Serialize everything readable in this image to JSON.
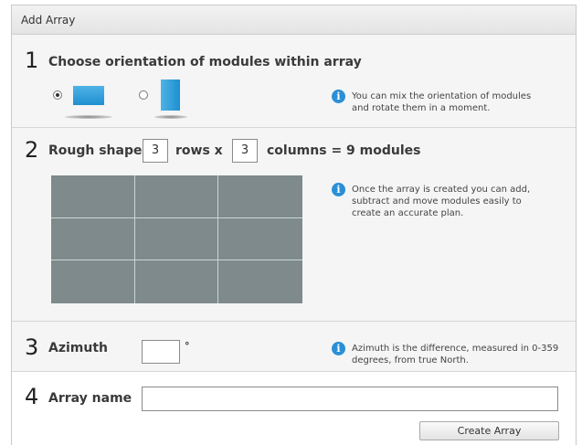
{
  "dialog": {
    "title": "Add Array"
  },
  "step1": {
    "number": "1",
    "heading": "Choose orientation of modules within array",
    "orientations": [
      {
        "name": "landscape",
        "selected": true
      },
      {
        "name": "portrait",
        "selected": false
      }
    ],
    "info_icon": "info-icon",
    "info_line1": "You can mix the orientation of modules",
    "info_line2": "and rotate them in a moment."
  },
  "step2": {
    "number": "2",
    "label_prefix": "Rough shape",
    "rows_value": "3",
    "rows_label": "rows x",
    "columns_value": "3",
    "columns_label": "columns = 9 modules",
    "grid_rows": 3,
    "grid_columns": 3,
    "info_line1": "Once the array is created you can add,",
    "info_line2": "subtract and move modules easily to",
    "info_line3": "create an accurate plan."
  },
  "step3": {
    "number": "3",
    "label": "Azimuth",
    "value": "",
    "unit": "°",
    "info_line1": "Azimuth is the difference, measured in 0-359",
    "info_line2": "degrees, from true North."
  },
  "step4": {
    "number": "4",
    "label": "Array name",
    "value": "",
    "button_label": "Create Array"
  },
  "colors": {
    "accent": "#2b8fd6",
    "module": "#1e8fd0",
    "grid": "#7e8a8c",
    "grid_lines": "#c8d8d0"
  }
}
